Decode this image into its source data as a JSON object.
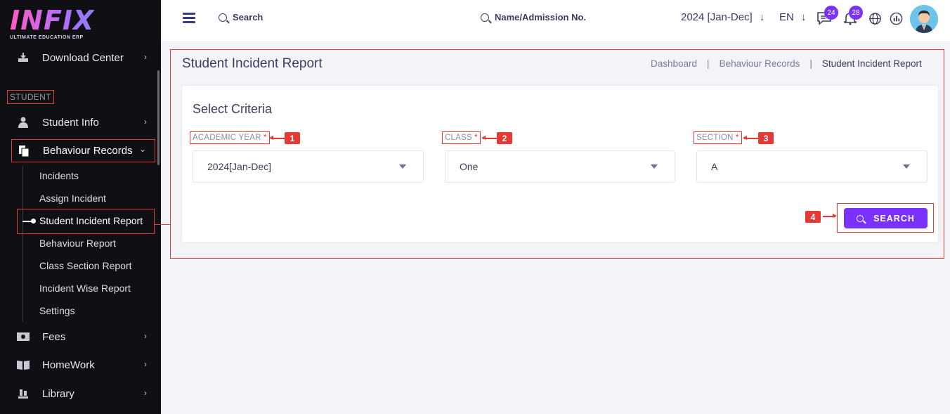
{
  "logo": {
    "text": "INFIX",
    "subtitle": "ULTIMATE EDUCATION ERP"
  },
  "sidebar": {
    "top_item": {
      "label": "Download Center",
      "icon": "download-icon"
    },
    "section_label": "STUDENT",
    "items": [
      {
        "label": "Student Info",
        "icon": "user-icon"
      },
      {
        "label": "Behaviour Records",
        "icon": "document-icon"
      }
    ],
    "sub_items": [
      "Incidents",
      "Assign Incident",
      "Student Incident Report",
      "Behaviour Report",
      "Class Section Report",
      "Incident Wise Report",
      "Settings"
    ],
    "bottom_items": [
      {
        "label": "Fees",
        "icon": "money-icon"
      },
      {
        "label": "HomeWork",
        "icon": "book-icon"
      },
      {
        "label": "Library",
        "icon": "library-icon"
      }
    ]
  },
  "topbar": {
    "search_label": "Search",
    "student_search_label": "Name/Admission No.",
    "year": "2024 [Jan-Dec]",
    "lang": "EN",
    "messages_count": "24",
    "notifications_count": "28"
  },
  "page": {
    "title": "Student Incident Report",
    "breadcrumb": [
      "Dashboard",
      "Behaviour Records",
      "Student Incident Report"
    ],
    "card_title": "Select Criteria",
    "fields": [
      {
        "label": "ACADEMIC YEAR",
        "value": "2024[Jan-Dec]",
        "callout": "1"
      },
      {
        "label": "CLASS",
        "value": "One",
        "callout": "2"
      },
      {
        "label": "SECTION",
        "value": "A",
        "callout": "3"
      }
    ],
    "required_mark": "*",
    "search_button": "SEARCH",
    "search_callout": "4"
  },
  "colors": {
    "accent": "#7c32ff",
    "annotation": "#e53935",
    "sidebar_bg": "#0f0f14"
  }
}
